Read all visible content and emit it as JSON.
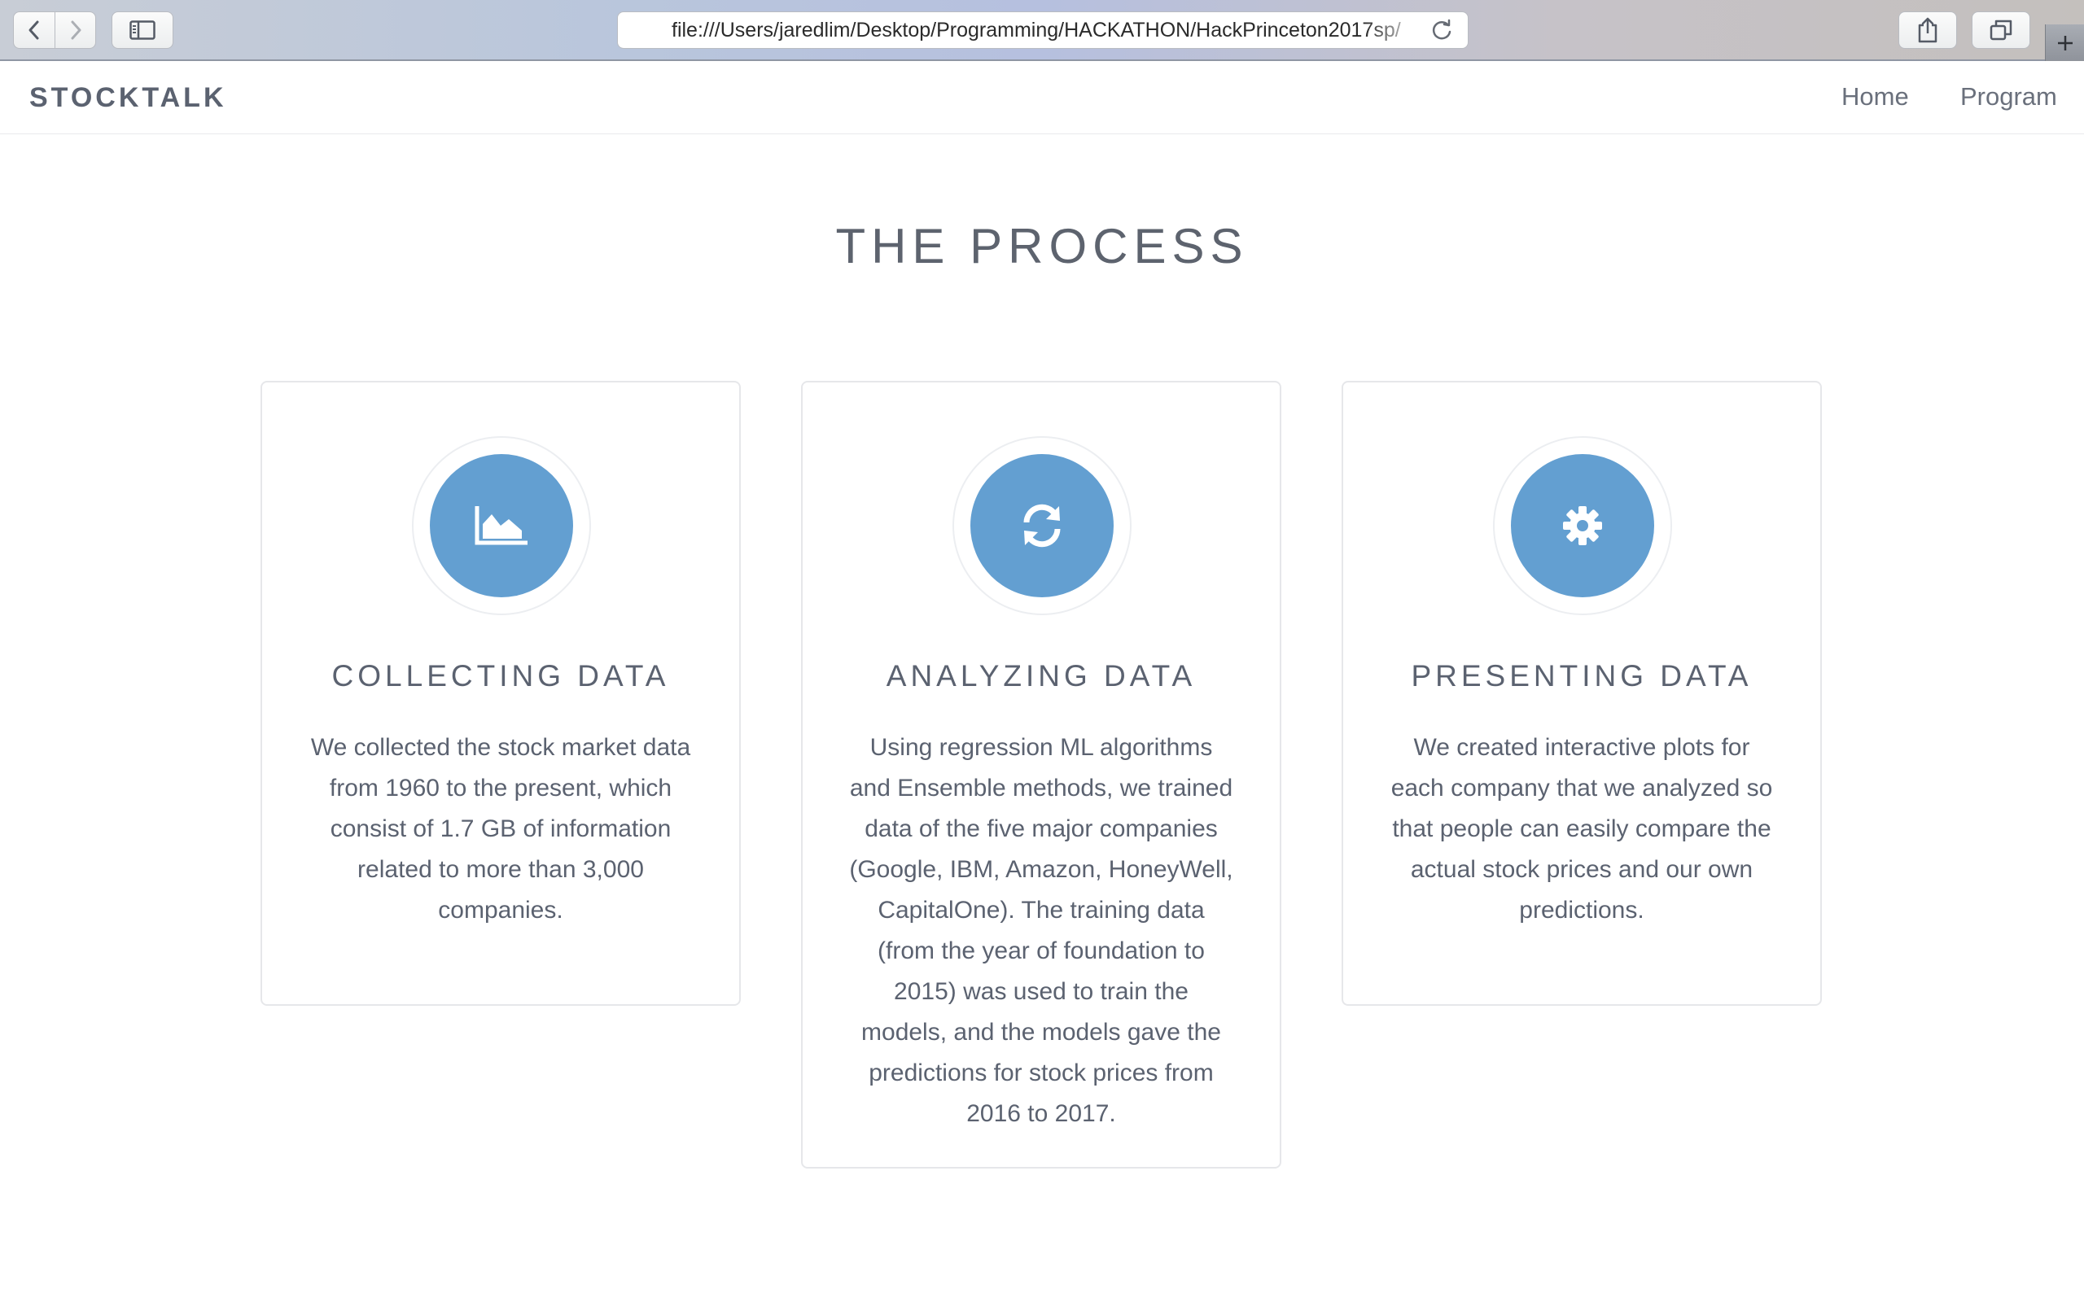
{
  "browser": {
    "url": "file:///Users/jaredlim/Desktop/Programming/HACKATHON/HackPrinceton2017sp/",
    "icons": {
      "back": "chevron-left-icon",
      "forward": "chevron-right-icon",
      "sidebar": "sidebar-icon",
      "reload": "reload-icon",
      "share": "share-icon",
      "tabs": "tabs-icon",
      "new_tab": "plus-icon"
    }
  },
  "navbar": {
    "brand": "STOCKTALK",
    "links": [
      "Home",
      "Program"
    ]
  },
  "main": {
    "title": "THE PROCESS",
    "accent_color": "#639fd1",
    "cards": [
      {
        "icon": "area-chart-icon",
        "title": "COLLECTING DATA",
        "text": "We collected the stock market data from 1960 to the present, which consist of 1.7 GB of information related to more than 3,000 companies."
      },
      {
        "icon": "refresh-icon",
        "title": "ANALYZING DATA",
        "text": "Using regression ML algorithms and Ensemble methods, we trained data of the five major companies (Google, IBM, Amazon, HoneyWell, CapitalOne). The training data (from the year of foundation to 2015) was used to train the models, and the models gave the predictions for stock prices from 2016 to 2017."
      },
      {
        "icon": "gear-icon",
        "title": "PRESENTING DATA",
        "text": "We created interactive plots for each company that we analyzed so that people can easily compare the actual stock prices and our own predictions."
      }
    ]
  }
}
